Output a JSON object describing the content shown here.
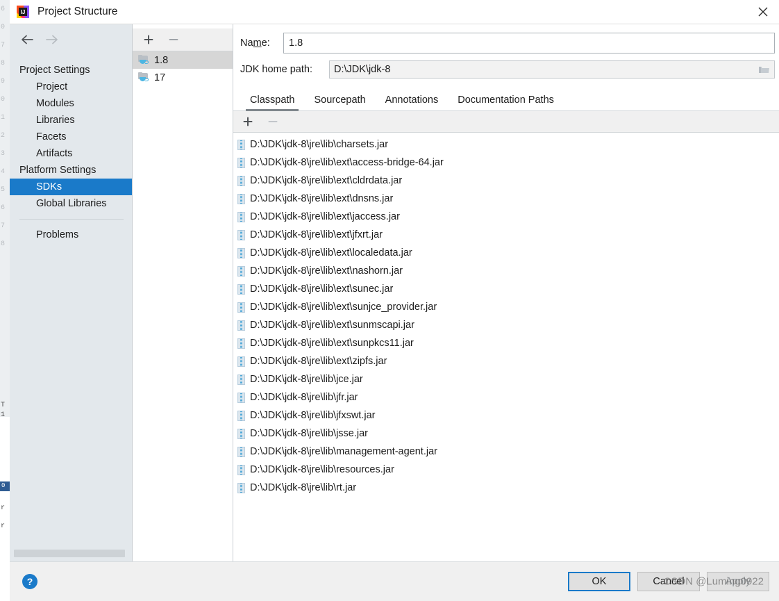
{
  "window": {
    "title": "Project Structure",
    "app_icon": "intellij-idea-icon",
    "close_icon": "close-icon"
  },
  "sidebar": {
    "back_icon": "arrow-left-icon",
    "forward_icon": "arrow-right-icon",
    "groups": [
      {
        "label": "Project Settings",
        "items": [
          {
            "label": "Project",
            "selected": false
          },
          {
            "label": "Modules",
            "selected": false
          },
          {
            "label": "Libraries",
            "selected": false
          },
          {
            "label": "Facets",
            "selected": false
          },
          {
            "label": "Artifacts",
            "selected": false
          }
        ]
      },
      {
        "label": "Platform Settings",
        "items": [
          {
            "label": "SDKs",
            "selected": true
          },
          {
            "label": "Global Libraries",
            "selected": false
          }
        ]
      }
    ],
    "extra_items": [
      {
        "label": "Problems",
        "selected": false
      }
    ],
    "selection_color": "#1a7ac9"
  },
  "sdk_list": {
    "add_icon": "plus-icon",
    "remove_icon": "minus-icon",
    "items": [
      {
        "label": "1.8",
        "icon": "jdk-folder-icon",
        "selected": true
      },
      {
        "label": "17",
        "icon": "jdk-folder-icon",
        "selected": false
      }
    ]
  },
  "detail": {
    "name_label": "Name:",
    "name_label_mnemonic": "m",
    "name_value": "1.8",
    "path_label": "JDK home path:",
    "path_value": "D:\\JDK\\jdk-8",
    "browse_icon": "folder-open-icon",
    "tabs": [
      {
        "label": "Classpath",
        "active": true
      },
      {
        "label": "Sourcepath",
        "active": false
      },
      {
        "label": "Annotations",
        "active": false
      },
      {
        "label": "Documentation Paths",
        "active": false
      }
    ],
    "toolbar": {
      "add_icon": "plus-icon",
      "remove_icon": "minus-icon",
      "remove_enabled": false
    },
    "classpath_entries": [
      {
        "path": "D:\\JDK\\jdk-8\\jre\\lib\\charsets.jar",
        "icon": "jar-icon"
      },
      {
        "path": "D:\\JDK\\jdk-8\\jre\\lib\\ext\\access-bridge-64.jar",
        "icon": "jar-icon"
      },
      {
        "path": "D:\\JDK\\jdk-8\\jre\\lib\\ext\\cldrdata.jar",
        "icon": "jar-icon"
      },
      {
        "path": "D:\\JDK\\jdk-8\\jre\\lib\\ext\\dnsns.jar",
        "icon": "jar-icon"
      },
      {
        "path": "D:\\JDK\\jdk-8\\jre\\lib\\ext\\jaccess.jar",
        "icon": "jar-icon"
      },
      {
        "path": "D:\\JDK\\jdk-8\\jre\\lib\\ext\\jfxrt.jar",
        "icon": "jar-icon"
      },
      {
        "path": "D:\\JDK\\jdk-8\\jre\\lib\\ext\\localedata.jar",
        "icon": "jar-icon"
      },
      {
        "path": "D:\\JDK\\jdk-8\\jre\\lib\\ext\\nashorn.jar",
        "icon": "jar-icon"
      },
      {
        "path": "D:\\JDK\\jdk-8\\jre\\lib\\ext\\sunec.jar",
        "icon": "jar-icon"
      },
      {
        "path": "D:\\JDK\\jdk-8\\jre\\lib\\ext\\sunjce_provider.jar",
        "icon": "jar-icon"
      },
      {
        "path": "D:\\JDK\\jdk-8\\jre\\lib\\ext\\sunmscapi.jar",
        "icon": "jar-icon"
      },
      {
        "path": "D:\\JDK\\jdk-8\\jre\\lib\\ext\\sunpkcs11.jar",
        "icon": "jar-icon"
      },
      {
        "path": "D:\\JDK\\jdk-8\\jre\\lib\\ext\\zipfs.jar",
        "icon": "jar-icon"
      },
      {
        "path": "D:\\JDK\\jdk-8\\jre\\lib\\jce.jar",
        "icon": "jar-icon"
      },
      {
        "path": "D:\\JDK\\jdk-8\\jre\\lib\\jfr.jar",
        "icon": "jar-icon"
      },
      {
        "path": "D:\\JDK\\jdk-8\\jre\\lib\\jfxswt.jar",
        "icon": "jar-icon"
      },
      {
        "path": "D:\\JDK\\jdk-8\\jre\\lib\\jsse.jar",
        "icon": "jar-icon"
      },
      {
        "path": "D:\\JDK\\jdk-8\\jre\\lib\\management-agent.jar",
        "icon": "jar-icon"
      },
      {
        "path": "D:\\JDK\\jdk-8\\jre\\lib\\resources.jar",
        "icon": "jar-icon"
      },
      {
        "path": "D:\\JDK\\jdk-8\\jre\\lib\\rt.jar",
        "icon": "jar-icon"
      }
    ]
  },
  "footer": {
    "help_label": "?",
    "buttons": [
      {
        "label": "OK",
        "style": "default"
      },
      {
        "label": "Cancel",
        "style": "normal"
      },
      {
        "label": "Apply",
        "style": "disabled",
        "mnemonic": "A"
      }
    ],
    "watermark": "CSDN @Luming0922"
  }
}
